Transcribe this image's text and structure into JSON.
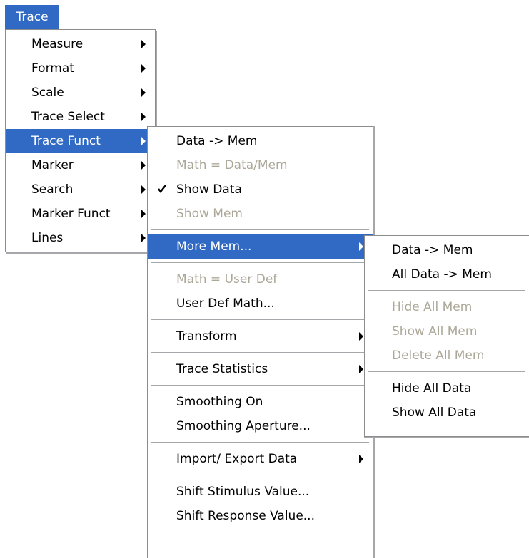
{
  "menubar": {
    "trace": "Trace"
  },
  "trace_menu": {
    "items": [
      {
        "label": "Measure"
      },
      {
        "label": "Format"
      },
      {
        "label": "Scale"
      },
      {
        "label": "Trace Select"
      },
      {
        "label": "Trace Funct"
      },
      {
        "label": "Marker"
      },
      {
        "label": "Search"
      },
      {
        "label": "Marker Funct"
      },
      {
        "label": "Lines"
      }
    ]
  },
  "trace_funct_menu": {
    "data_to_mem": "Data -> Mem",
    "math_data_mem": "Math = Data/Mem",
    "show_data": "Show Data",
    "show_mem": "Show Mem",
    "more_mem": "More Mem...",
    "math_user_def": "Math = User Def",
    "user_def_math": "User Def Math...",
    "transform": "Transform",
    "trace_statistics": "Trace Statistics",
    "smoothing_on": "Smoothing On",
    "smoothing_aperture": "Smoothing Aperture...",
    "import_export": "Import/ Export Data",
    "shift_stimulus": "Shift Stimulus Value...",
    "shift_response": "Shift Response Value..."
  },
  "more_mem_menu": {
    "data_to_mem": "Data -> Mem",
    "all_data_to_mem": "All Data -> Mem",
    "hide_all_mem": "Hide All Mem",
    "show_all_mem": "Show All Mem",
    "delete_all_mem": "Delete All Mem",
    "hide_all_data": "Hide All Data",
    "show_all_data": "Show All Data"
  },
  "colors": {
    "highlight": "#316ac5",
    "disabled_text": "#aca899"
  }
}
